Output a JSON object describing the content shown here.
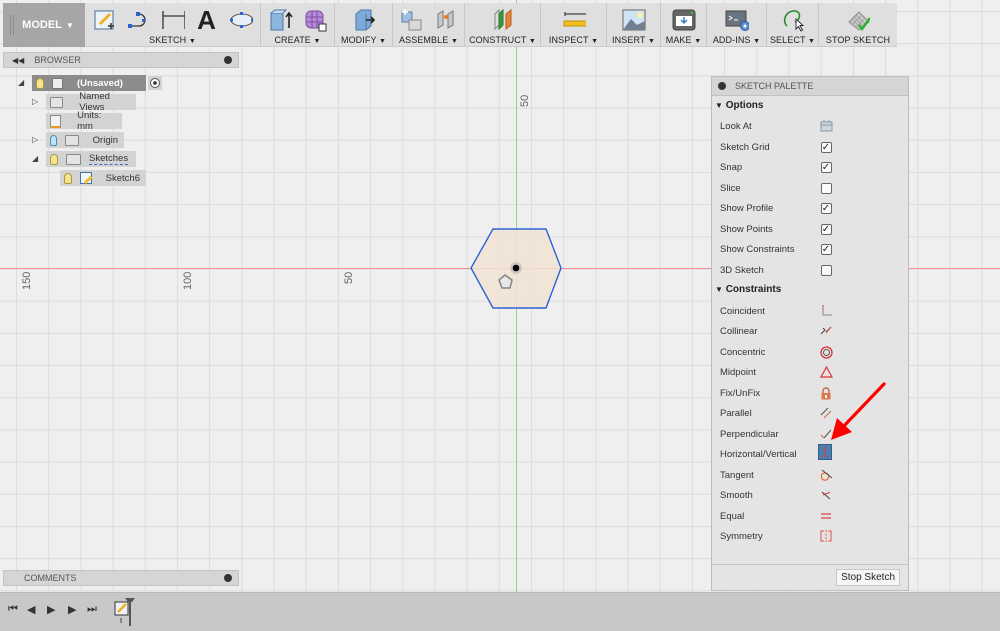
{
  "toolbar": {
    "workspace": "MODEL",
    "groups": [
      {
        "label": "SKETCH",
        "icons": [
          "create-sketch-icon",
          "spline-icon",
          "dimension-icon",
          "text-icon",
          "ellipse-icon"
        ]
      },
      {
        "label": "CREATE",
        "icons": [
          "extrude-icon",
          "form-icon"
        ]
      },
      {
        "label": "MODIFY",
        "icons": [
          "press-pull-icon"
        ]
      },
      {
        "label": "ASSEMBLE",
        "icons": [
          "new-component-icon",
          "joint-icon"
        ]
      },
      {
        "label": "CONSTRUCT",
        "icons": [
          "plane-icon"
        ]
      },
      {
        "label": "INSPECT",
        "icons": [
          "measure-icon"
        ]
      },
      {
        "label": "INSERT",
        "icons": [
          "insert-image-icon"
        ]
      },
      {
        "label": "MAKE",
        "icons": [
          "3d-print-icon"
        ]
      },
      {
        "label": "ADD-INS",
        "icons": [
          "scripts-icon"
        ]
      },
      {
        "label": "SELECT",
        "icons": [
          "lasso-select-icon"
        ]
      },
      {
        "label": "STOP SKETCH",
        "icons": [
          "stop-sketch-icon"
        ]
      }
    ],
    "dropdown_glyph": "▼"
  },
  "browser": {
    "title": "BROWSER",
    "items": [
      {
        "label": "(Unsaved)",
        "depth": 0
      },
      {
        "label": "Named Views",
        "depth": 1
      },
      {
        "label": "Units: mm",
        "depth": 1
      },
      {
        "label": "Origin",
        "depth": 1
      },
      {
        "label": "Sketches",
        "depth": 1
      },
      {
        "label": "Sketch6",
        "depth": 2
      }
    ]
  },
  "comments": {
    "title": "COMMENTS"
  },
  "canvas": {
    "ruler_labels": {
      "horizontal": [
        "150",
        "100",
        "50"
      ],
      "vertical": [
        "50"
      ]
    },
    "colors": {
      "x_axis": "#ef8f8f",
      "y_axis": "#8fd48f",
      "sketch_line": "#2e62d6",
      "profile_fill": "#f1e3d3"
    }
  },
  "sketch_palette": {
    "title": "SKETCH PALETTE",
    "options_header": "Options",
    "options": [
      {
        "label": "Look At",
        "control": "button"
      },
      {
        "label": "Sketch Grid",
        "control": "checkbox",
        "checked": true
      },
      {
        "label": "Snap",
        "control": "checkbox",
        "checked": true
      },
      {
        "label": "Slice",
        "control": "checkbox",
        "checked": false
      },
      {
        "label": "Show Profile",
        "control": "checkbox",
        "checked": true
      },
      {
        "label": "Show Points",
        "control": "checkbox",
        "checked": true
      },
      {
        "label": "Show Constraints",
        "control": "checkbox",
        "checked": true
      },
      {
        "label": "3D Sketch",
        "control": "checkbox",
        "checked": false
      }
    ],
    "constraints_header": "Constraints",
    "constraints": [
      {
        "label": "Coincident",
        "icon": "coincident-icon"
      },
      {
        "label": "Collinear",
        "icon": "collinear-icon"
      },
      {
        "label": "Concentric",
        "icon": "concentric-icon"
      },
      {
        "label": "Midpoint",
        "icon": "midpoint-icon"
      },
      {
        "label": "Fix/UnFix",
        "icon": "fix-lock-icon"
      },
      {
        "label": "Parallel",
        "icon": "parallel-icon"
      },
      {
        "label": "Perpendicular",
        "icon": "perpendicular-icon"
      },
      {
        "label": "Horizontal/Vertical",
        "icon": "horizontal-vertical-icon",
        "active": true
      },
      {
        "label": "Tangent",
        "icon": "tangent-icon"
      },
      {
        "label": "Smooth",
        "icon": "smooth-icon"
      },
      {
        "label": "Equal",
        "icon": "equal-icon"
      },
      {
        "label": "Symmetry",
        "icon": "symmetry-icon"
      }
    ],
    "stop_button": "Stop Sketch"
  },
  "timeline": {
    "controls": [
      "go-to-start",
      "step-back",
      "play",
      "step-forward",
      "go-to-end"
    ]
  },
  "annotation": {
    "arrow_color": "#ff0000"
  }
}
